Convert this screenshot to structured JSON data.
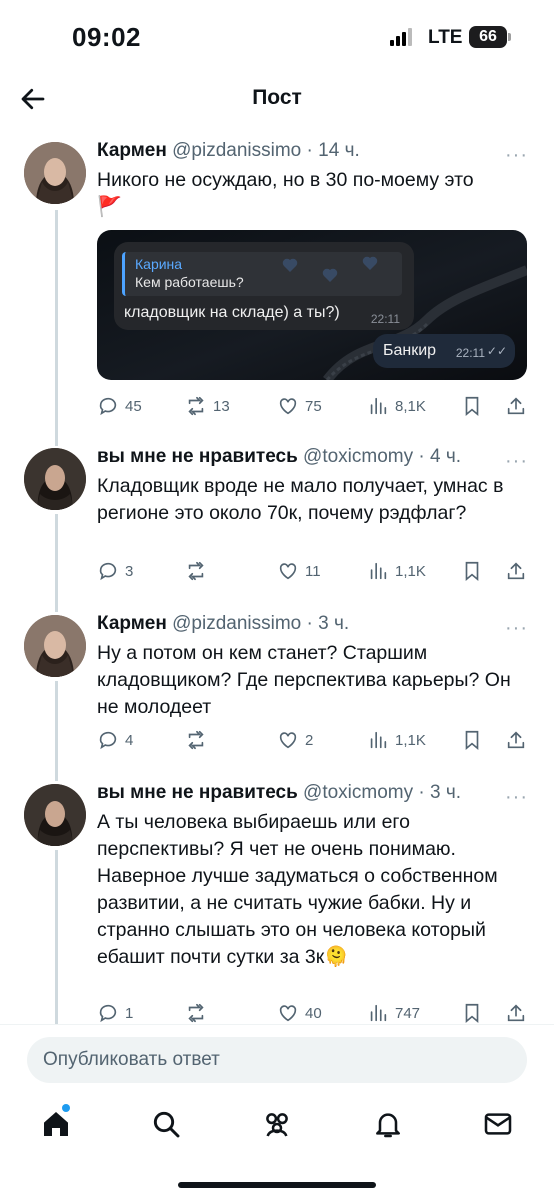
{
  "status": {
    "time": "09:02",
    "network": "LTE",
    "battery": "66"
  },
  "nav": {
    "title": "Пост"
  },
  "tweets": [
    {
      "name": "Кармен",
      "handle": "@pizdanissimo",
      "time": "· 14 ч.",
      "text": "Никого не осуждаю, но в 30 по-моему это",
      "flag": "🚩",
      "media": {
        "quote_name": "Карина",
        "quote_text": "Кем работаешь?",
        "reply_text": "кладовщик на складе) а ты?)",
        "reply_time": "22:11",
        "out_text": "Банкир",
        "out_time": "22:11",
        "out_ticks": "✓✓"
      },
      "stats": {
        "replies": "45",
        "retweets": "13",
        "likes": "75",
        "views": "8,1K"
      }
    },
    {
      "name": "вы мне не нравитесь",
      "handle": "@toxicmomy",
      "time": "· 4 ч.",
      "text": "Кладовщик вроде не мало получает, умнас в регионе это около 70к, почему рэдфлаг?",
      "stats": {
        "replies": "3",
        "retweets": "",
        "likes": "11",
        "views": "1,1K"
      }
    },
    {
      "name": "Кармен",
      "handle": "@pizdanissimo",
      "time": "· 3 ч.",
      "text": "Ну а потом он кем станет? Старшим кладовщиком? Где перспектива карьеры? Он не молодеет",
      "stats": {
        "replies": "4",
        "retweets": "",
        "likes": "2",
        "views": "1,1K"
      }
    },
    {
      "name": "вы мне не нравитесь",
      "handle": "@toxicmomy",
      "time": "· 3 ч.",
      "text": "А ты человека выбираешь или его перспективы? Я чет не очень понимаю. Наверное лучше задуматься о собственном развитии, а не считать чужие бабки. Ну и странно слышать это он человека который ебашит почти сутки за 3к🫠",
      "stats": {
        "replies": "1",
        "retweets": "",
        "likes": "40",
        "views": "747"
      }
    }
  ],
  "more_label": "···",
  "reply_bar": {
    "placeholder": "Опубликовать ответ"
  },
  "icons": [
    "back-arrow-icon",
    "reply-icon",
    "retweet-icon",
    "like-icon",
    "views-icon",
    "bookmark-icon",
    "share-icon",
    "home-icon",
    "search-icon",
    "communities-icon",
    "notifications-icon",
    "messages-icon"
  ],
  "colors": {
    "text": "#0f1419",
    "secondary": "#536471",
    "accent": "#1d9bf0",
    "flag": "#e0245e"
  }
}
